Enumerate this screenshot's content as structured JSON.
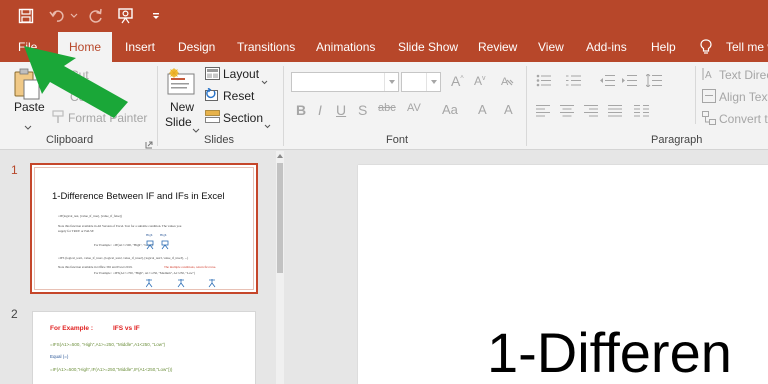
{
  "colors": {
    "accent": "#b7472a",
    "ribbon_bg": "#f3f3f3",
    "arrow": "#1aa738",
    "pane_bg": "#e6e6e6"
  },
  "qat": {
    "save_icon": "save-icon",
    "undo_icon": "undo-icon",
    "redo_icon": "redo-icon",
    "present_icon": "present-icon",
    "customize_icon": "customize-icon"
  },
  "tabs": [
    {
      "label": "File"
    },
    {
      "label": "Home"
    },
    {
      "label": "Insert"
    },
    {
      "label": "Design"
    },
    {
      "label": "Transitions"
    },
    {
      "label": "Animations"
    },
    {
      "label": "Slide Show"
    },
    {
      "label": "Review"
    },
    {
      "label": "View"
    },
    {
      "label": "Add-ins"
    },
    {
      "label": "Help"
    }
  ],
  "tellme": "Tell me w",
  "clipboard": {
    "paste": "Paste",
    "cut": "Cut",
    "copy": "Co",
    "format_painter": "Format Painter",
    "group": "Clipboard"
  },
  "slides": {
    "new_slide_1": "New",
    "new_slide_2": "Slide",
    "layout": "Layout",
    "reset": "Reset",
    "section": "Section",
    "group": "Slides"
  },
  "font": {
    "group": "Font"
  },
  "paragraph": {
    "group": "Paragraph",
    "text_direction": "Text Direc",
    "align_text": "Align Text",
    "convert": "Convert to"
  },
  "panel": {
    "slide1_number": "1",
    "slide2_number": "2",
    "thumb1": {
      "title": "1-Difference Between IF and IFs in Excel",
      "line1": "=IF(logical_test, [value_if_true], [value_if_false])",
      "line2": "Note this function available in All Version of Excel. Test for a suitable condition. The values you",
      "line3": "supply for TRUE or FALSE",
      "example1": "For Example :       =IF(A1>=500, \"High\", \"Low\")",
      "high": "High",
      "high2": "High",
      "line4": "=IFS (logical_test1, value_if_true1, [logical_test2, value_if_true2], [logical_test3, value_if_true3], ...)",
      "line5": "Note this function available in Office 365 and Excel 2019.",
      "line5_red": "The multiple conditions, return first true.",
      "example2": "For Example :       =IFS(A1>=700, \"High\", A1>=250, \"Medium\", A1<250, \"Low\")"
    },
    "thumb2": {
      "example_label": "For Example :",
      "ifs_vs_if": "IFS vs IF",
      "formula1": "=IFS(A1>=500, \"High\",A1>=250, \"Middle\",A1<250, \"Low\")",
      "equal": "Equal (=)",
      "formula2": "=IF(A1>=500,\"High\",IF(A1>=250,\"Middle\",IF(A1<250,\"Low\")))"
    }
  },
  "editor": {
    "title_visible": "1-Differen"
  }
}
